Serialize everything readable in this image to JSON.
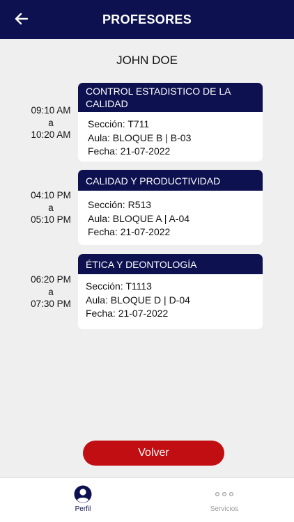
{
  "header": {
    "title": "PROFESORES",
    "back_icon": "arrow-left-icon"
  },
  "teacher": {
    "name": "JOHN DOE"
  },
  "schedule": [
    {
      "start": "09:10 AM",
      "sep": "a",
      "end": "10:20 AM",
      "course": "CONTROL ESTADISTICO DE LA CALIDAD",
      "section": "Sección: T711",
      "room": "Aula: BLOQUE B | B-03",
      "date": "Fecha: 21-07-2022"
    },
    {
      "start": "04:10 PM",
      "sep": "a",
      "end": "05:10 PM",
      "course": "CALIDAD Y PRODUCTIVIDAD",
      "section": "Sección: R513",
      "room": "Aula: BLOQUE A | A-04",
      "date": "Fecha: 21-07-2022"
    },
    {
      "start": "06:20 PM",
      "sep": "a",
      "end": "07:30 PM",
      "course": "ÉTICA Y DEONTOLOGÍA",
      "section": "Sección: T1113",
      "room": "Aula: BLOQUE D | D-04",
      "date": "Fecha: 21-07-2022"
    }
  ],
  "actions": {
    "volver_label": "Volver"
  },
  "tabbar": {
    "profile_label": "Perfil",
    "services_label": "Servicios"
  },
  "colors": {
    "primary": "#0d1150",
    "accent": "#c10e12",
    "background": "#efefef"
  }
}
